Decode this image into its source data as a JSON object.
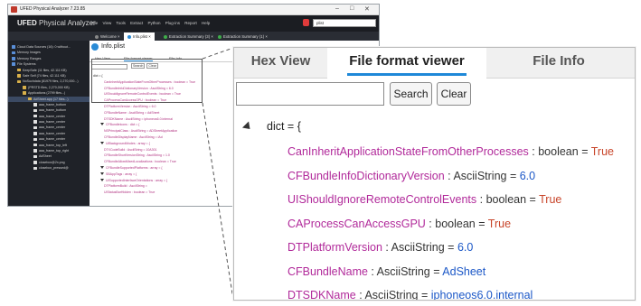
{
  "window": {
    "title": "UFED Physical Analyzer 7.23.85",
    "controls": [
      "–",
      "□",
      "✕"
    ],
    "brand_main": "UFED",
    "brand_sub": "Physical Analyzer",
    "menus": [
      "File",
      "View",
      "Tools",
      "Extract",
      "Python",
      "Plug-ins",
      "Report",
      "Help"
    ],
    "search_value": "plist"
  },
  "tabs": [
    {
      "label": "Welcome",
      "color": "#888888"
    },
    {
      "label": "Info.plist",
      "color": "#2a8bd6",
      "active": true
    },
    {
      "label": "Extraction Summary (3)",
      "color": "#3fae4a"
    },
    {
      "label": "Extraction Summary (1)",
      "color": "#3fae4a"
    }
  ],
  "tree": [
    {
      "label": "Cloud Data Sources (16): 0 without...",
      "depth": 0,
      "icon": "b"
    },
    {
      "label": "Memory Images",
      "depth": 0,
      "icon": "b"
    },
    {
      "label": "Memory Ranges",
      "depth": 0,
      "icon": "b"
    },
    {
      "label": "File Systems",
      "depth": 0,
      "icon": "b"
    },
    {
      "label": "KeepSafe (11 files, 42.111 KB)",
      "depth": 1,
      "icon": "y"
    },
    {
      "label": "Safe Self (74 files, 42.111 KB)",
      "depth": 1,
      "icon": "y"
    },
    {
      "label": "NoSuchdata (81979 files, 2,270,000...)",
      "depth": 1,
      "icon": "y"
    },
    {
      "label": "(PRSTD files, 2,270,000 KB)",
      "depth": 2,
      "icon": "y"
    },
    {
      "label": "Applications (2799 files...)",
      "depth": 2,
      "icon": "y"
    },
    {
      "label": "AdSheet.app (17 files...)",
      "depth": 3,
      "icon": "y",
      "selected": true
    },
    {
      "label": "aaa_frame_bottom",
      "depth": 4,
      "icon": "w"
    },
    {
      "label": "aaa_frame_bottom",
      "depth": 4,
      "icon": "w"
    },
    {
      "label": "aaa_frame_center",
      "depth": 4,
      "icon": "w"
    },
    {
      "label": "aaa_frame_center",
      "depth": 4,
      "icon": "w"
    },
    {
      "label": "aaa_frame_center",
      "depth": 4,
      "icon": "w"
    },
    {
      "label": "aaa_frame_center",
      "depth": 4,
      "icon": "w"
    },
    {
      "label": "aaa_frame_center",
      "depth": 4,
      "icon": "w"
    },
    {
      "label": "aaa_frame_top_left",
      "depth": 4,
      "icon": "w"
    },
    {
      "label": "aaa_frame_top_right",
      "depth": 4,
      "icon": "w"
    },
    {
      "label": "AdSheet",
      "depth": 4,
      "icon": "w"
    },
    {
      "label": "closebox@2x.png",
      "depth": 4,
      "icon": "w"
    },
    {
      "label": "closebox_pressed@",
      "depth": 4,
      "icon": "w"
    }
  ],
  "pane": {
    "title": "Info.plist",
    "subtabs": [
      "Hex View",
      "File format viewer",
      "File Info"
    ],
    "search_button": "Search",
    "clear_button": "Clear",
    "mini_lines": [
      {
        "text": "dict = {",
        "root": true
      },
      {
        "text": "CanInheritApplicationStateFromOtherProcesses : boolean = True"
      },
      {
        "text": "CFBundleInfoDictionaryVersion : AsciiString = 6.0"
      },
      {
        "text": "UIShouldIgnoreRemoteControlEvents : boolean = True"
      },
      {
        "text": "CAProcessCanAccessGPU : boolean = True"
      },
      {
        "text": "DTPlatformVersion : AsciiString = 6.0"
      },
      {
        "text": "CFBundleName : AsciiString = AdSheet"
      },
      {
        "text": "DTSDKName : AsciiString = iphoneos6.0.internal"
      },
      {
        "text": "CFBundleIcons : dict = {",
        "tri": true
      },
      {
        "text": "NSPrincipalClass : AsciiString = ADSheetApplication"
      },
      {
        "text": "CFBundleDisplayName : AsciiString = iAd"
      },
      {
        "text": "UIBackgroundModes : array = {",
        "tri": true
      },
      {
        "text": "DTXCodeBuild : AsciiString = 10A301"
      },
      {
        "text": "CFBundleShortVersionString : AsciiString = 1.0"
      },
      {
        "text": "CFBundleAllowMixedLocalizations : boolean = True"
      },
      {
        "text": "CFBundleSupportedPlatforms : array = {",
        "tri": true
      },
      {
        "text": "SBAppTags : array = {",
        "tri": true
      },
      {
        "text": "UISupportedInterfaceOrientations : array = {",
        "tri": true
      },
      {
        "text": "DTPlatformBuild : AsciiString ="
      },
      {
        "text": "UIStatusBarHidden : boolean = True"
      }
    ]
  },
  "zoom": {
    "tabs": [
      "Hex View",
      "File format viewer",
      "File Info"
    ],
    "search_value": "",
    "search_button": "Search",
    "clear_button": "Clear",
    "root": "dict = {",
    "entries": [
      {
        "key": "CanInheritApplicationStateFromOtherProcesses",
        "type": "boolean",
        "value": "True"
      },
      {
        "key": "CFBundleInfoDictionaryVersion",
        "type": "AsciiString",
        "value": "6.0"
      },
      {
        "key": "UIShouldIgnoreRemoteControlEvents",
        "type": "boolean",
        "value": "True"
      },
      {
        "key": "CAProcessCanAccessGPU",
        "type": "boolean",
        "value": "True"
      },
      {
        "key": "DTPlatformVersion",
        "type": "AsciiString",
        "value": "6.0"
      },
      {
        "key": "CFBundleName",
        "type": "AsciiString",
        "value": "AdSheet"
      },
      {
        "key": "DTSDKName",
        "type": "AsciiString",
        "value": "iphoneos6.0.internal"
      }
    ]
  },
  "colors": {
    "key": "#b1299a",
    "bool_value": "#c8452a",
    "string_value": "#1b57c7",
    "accent": "#1e88d8"
  }
}
